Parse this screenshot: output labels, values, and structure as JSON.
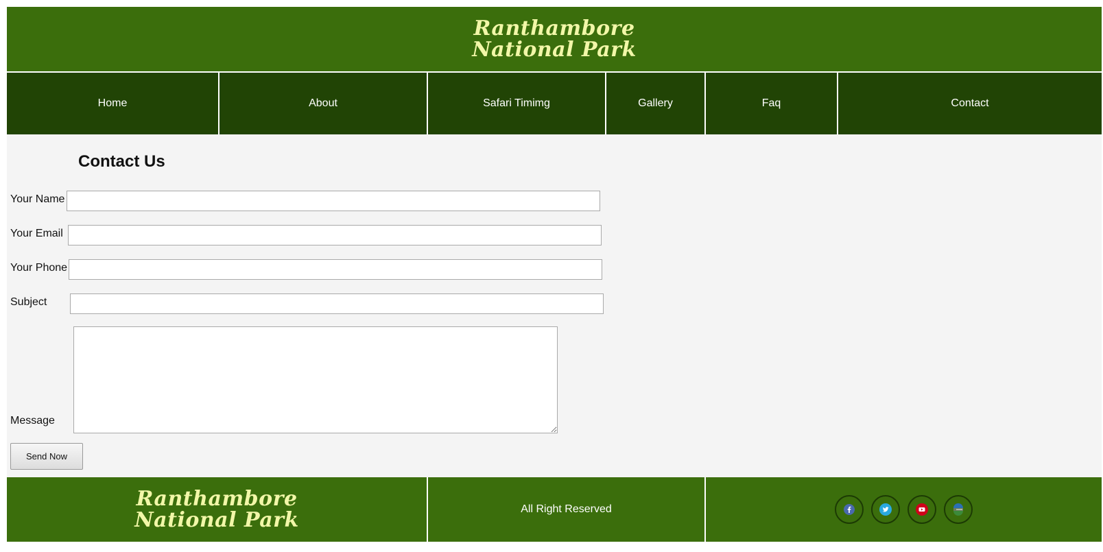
{
  "header": {
    "logo_line1": "Ranthambore",
    "logo_line2": "National Park"
  },
  "nav": {
    "items": [
      {
        "label": "Home"
      },
      {
        "label": "About"
      },
      {
        "label": "Safari Timimg"
      },
      {
        "label": "Gallery"
      },
      {
        "label": "Faq"
      },
      {
        "label": "Contact"
      }
    ]
  },
  "form": {
    "title": "Contact Us",
    "name_label": "Your Name",
    "email_label": "Your Email",
    "phone_label": "Your Phone",
    "subject_label": "Subject",
    "message_label": "Message",
    "name_value": "",
    "email_value": "",
    "phone_value": "",
    "subject_value": "",
    "message_value": "",
    "submit_label": "Send Now"
  },
  "footer": {
    "logo_line1": "Ranthambore",
    "logo_line2": "National Park",
    "copyright": "All Right Reserved",
    "social": [
      {
        "icon": "facebook-icon",
        "color": "#4a69ad"
      },
      {
        "icon": "twitter-icon",
        "color": "#2aa9e0"
      },
      {
        "icon": "youtube-icon",
        "color": "#d0021b"
      },
      {
        "icon": "email-icon",
        "color": "#2b6fb5"
      }
    ]
  }
}
